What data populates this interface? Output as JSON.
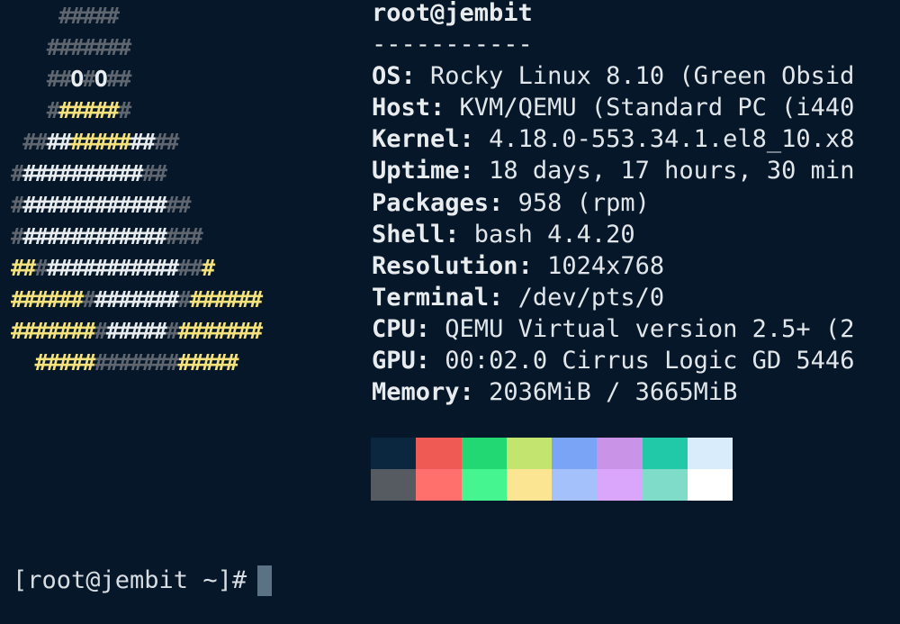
{
  "logo": [
    [
      [
        "dim",
        "    #####"
      ]
    ],
    [
      [
        "dim",
        "   #######"
      ]
    ],
    [
      [
        "dim",
        "   ##"
      ],
      [
        "white",
        "O"
      ],
      [
        "dim",
        "#"
      ],
      [
        "white",
        "O"
      ],
      [
        "dim",
        "##"
      ]
    ],
    [
      [
        "dim",
        "   #"
      ],
      [
        "yellow",
        "#####"
      ],
      [
        "dim",
        "#"
      ]
    ],
    [
      [
        "dim",
        " ##"
      ],
      [
        "white",
        "##"
      ],
      [
        "yellow",
        "#####"
      ],
      [
        "white",
        "##"
      ],
      [
        "dim",
        "##"
      ]
    ],
    [
      [
        "dim",
        "#"
      ],
      [
        "white",
        "##########"
      ],
      [
        "dim",
        "##"
      ]
    ],
    [
      [
        "dim",
        "#"
      ],
      [
        "white",
        "############"
      ],
      [
        "dim",
        "##"
      ]
    ],
    [
      [
        "dim",
        "#"
      ],
      [
        "white",
        "############"
      ],
      [
        "dim",
        "###"
      ]
    ],
    [
      [
        "yellow",
        "##"
      ],
      [
        "dim",
        "#"
      ],
      [
        "white",
        "###########"
      ],
      [
        "dim",
        "##"
      ],
      [
        "yellow",
        "#"
      ]
    ],
    [
      [
        "yellow",
        "######"
      ],
      [
        "dim",
        "#"
      ],
      [
        "white",
        "#######"
      ],
      [
        "dim",
        "#"
      ],
      [
        "yellow",
        "######"
      ]
    ],
    [
      [
        "yellow",
        "#######"
      ],
      [
        "dim",
        "#"
      ],
      [
        "white",
        "#####"
      ],
      [
        "dim",
        "#"
      ],
      [
        "yellow",
        "#######"
      ]
    ],
    [
      [
        "yellow",
        "  #####"
      ],
      [
        "dim",
        "#######"
      ],
      [
        "yellow",
        "#####"
      ]
    ]
  ],
  "info": {
    "user": "root@jembit",
    "separator": "-----------",
    "rows": [
      {
        "key": "OS",
        "value": "Rocky Linux 8.10 (Green Obsid"
      },
      {
        "key": "Host",
        "value": "KVM/QEMU (Standard PC (i440"
      },
      {
        "key": "Kernel",
        "value": "4.18.0-553.34.1.el8_10.x8"
      },
      {
        "key": "Uptime",
        "value": "18 days, 17 hours, 30 min"
      },
      {
        "key": "Packages",
        "value": "958 (rpm)"
      },
      {
        "key": "Shell",
        "value": "bash 4.4.20"
      },
      {
        "key": "Resolution",
        "value": "1024x768"
      },
      {
        "key": "Terminal",
        "value": "/dev/pts/0"
      },
      {
        "key": "CPU",
        "value": "QEMU Virtual version 2.5+ (2"
      },
      {
        "key": "GPU",
        "value": "00:02.0 Cirrus Logic GD 5446"
      },
      {
        "key": "Memory",
        "value": "2036MiB / 3665MiB"
      }
    ]
  },
  "palette": {
    "normal": [
      "#0b2740",
      "#f05a55",
      "#22d873",
      "#c3e46f",
      "#7aa4f5",
      "#c993e8",
      "#22c9a9",
      "#d9ecfb"
    ],
    "bright": [
      "#555b61",
      "#ff6f6b",
      "#45f58f",
      "#fbe592",
      "#a4c1fb",
      "#d9a6fb",
      "#7fdcc9",
      "#ffffff"
    ]
  },
  "prompt": {
    "text": "[root@jembit ~]#"
  },
  "colors": {
    "background": "#061729",
    "logo_dim": "#5f6670",
    "logo_white": "#e8ecef",
    "logo_yellow": "#f5e27a",
    "cursor": "#5b7285"
  }
}
